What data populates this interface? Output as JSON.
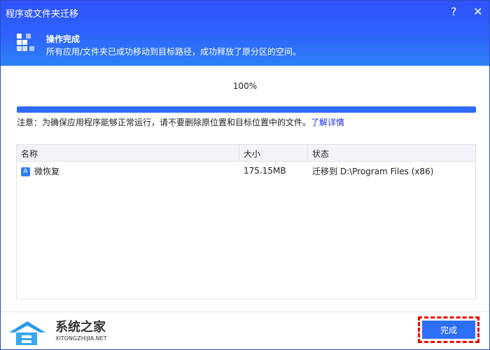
{
  "window": {
    "title": "程序或文件夹迁移",
    "help_label": "?",
    "close_label": "✕"
  },
  "banner": {
    "title": "操作完成",
    "subtitle": "所有应用/文件夹已成功移动到目标路径，成功释放了原分区的空间。"
  },
  "progress": {
    "label": "100%",
    "value": 100
  },
  "note": {
    "text": "注意：为确保应用程序能够正常运行，请不要删除原位置和目标位置中的文件。",
    "link": "了解详情"
  },
  "table": {
    "headers": [
      "名称",
      "大小",
      "状态"
    ],
    "rows": [
      {
        "name": "微恢复",
        "size": "175.15MB",
        "status": "迁移到 D:\\Program Files (x86)"
      }
    ]
  },
  "footer": {
    "done_label": "完成"
  },
  "watermark": {
    "cn": "系统之家",
    "en": "XITONGZHIJIA.NET"
  }
}
